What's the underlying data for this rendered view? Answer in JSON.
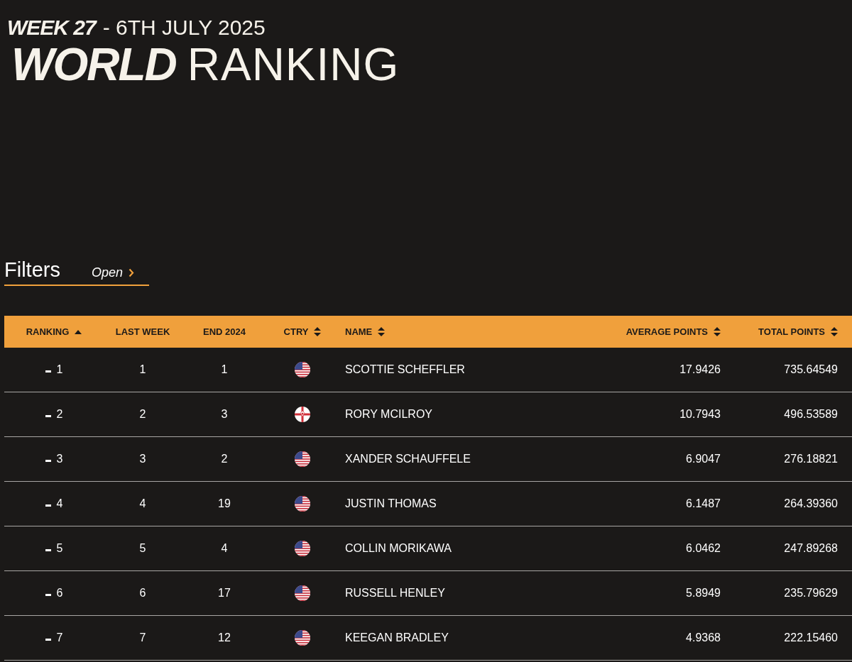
{
  "heading": {
    "week": "WEEK 27",
    "date": "- 6TH JULY 2025",
    "title_bold": "WORLD",
    "title_light": "RANKING"
  },
  "filters": {
    "label": "Filters",
    "toggle": "Open"
  },
  "table": {
    "columns": [
      {
        "label": "RANKING",
        "kind": "sort-asc"
      },
      {
        "label": "LAST WEEK",
        "kind": "plain"
      },
      {
        "label": "END 2024",
        "kind": "plain"
      },
      {
        "label": "CTRY",
        "kind": "sortable"
      },
      {
        "label": "NAME",
        "kind": "sortable"
      },
      {
        "label": "AVERAGE POINTS",
        "kind": "sortable"
      },
      {
        "label": "TOTAL POINTS",
        "kind": "sortable"
      }
    ],
    "rows": [
      {
        "movement": {
          "kind": "same"
        },
        "ranking": "1",
        "last_week": "1",
        "end_2024": "1",
        "flag": {
          "kind": "usa"
        },
        "name": "SCOTTIE SCHEFFLER",
        "average_points": "17.9426",
        "total_points": "735.64549"
      },
      {
        "movement": {
          "kind": "same"
        },
        "ranking": "2",
        "last_week": "2",
        "end_2024": "3",
        "flag": {
          "kind": "northern-ireland"
        },
        "name": "RORY MCILROY",
        "average_points": "10.7943",
        "total_points": "496.53589"
      },
      {
        "movement": {
          "kind": "same"
        },
        "ranking": "3",
        "last_week": "3",
        "end_2024": "2",
        "flag": {
          "kind": "usa"
        },
        "name": "XANDER SCHAUFFELE",
        "average_points": "6.9047",
        "total_points": "276.18821"
      },
      {
        "movement": {
          "kind": "same"
        },
        "ranking": "4",
        "last_week": "4",
        "end_2024": "19",
        "flag": {
          "kind": "usa"
        },
        "name": "JUSTIN THOMAS",
        "average_points": "6.1487",
        "total_points": "264.39360"
      },
      {
        "movement": {
          "kind": "same"
        },
        "ranking": "5",
        "last_week": "5",
        "end_2024": "4",
        "flag": {
          "kind": "usa"
        },
        "name": "COLLIN MORIKAWA",
        "average_points": "6.0462",
        "total_points": "247.89268"
      },
      {
        "movement": {
          "kind": "same"
        },
        "ranking": "6",
        "last_week": "6",
        "end_2024": "17",
        "flag": {
          "kind": "usa"
        },
        "name": "RUSSELL HENLEY",
        "average_points": "5.8949",
        "total_points": "235.79629"
      },
      {
        "movement": {
          "kind": "same"
        },
        "ranking": "7",
        "last_week": "7",
        "end_2024": "12",
        "flag": {
          "kind": "usa"
        },
        "name": "KEEGAN BRADLEY",
        "average_points": "4.9368",
        "total_points": "222.15460"
      }
    ]
  }
}
